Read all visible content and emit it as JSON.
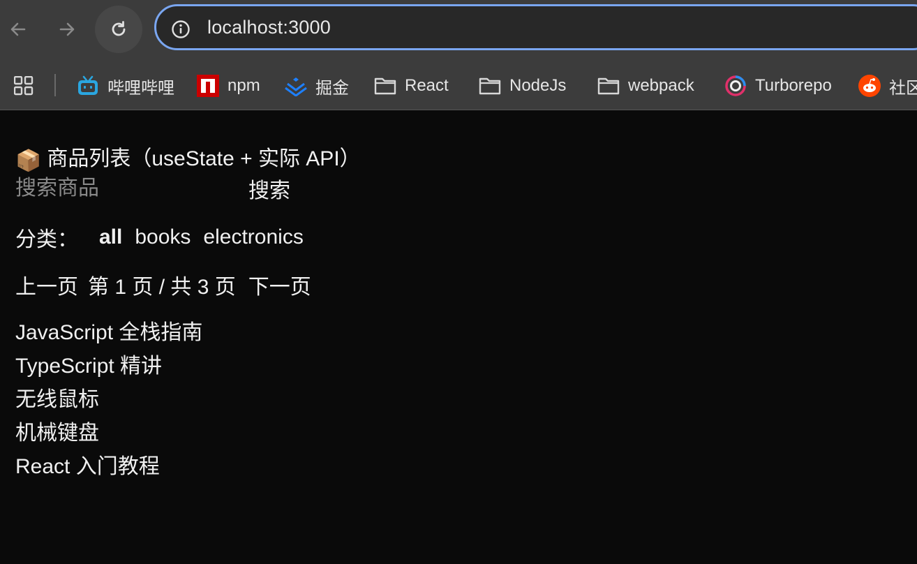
{
  "browser": {
    "url": "localhost:3000",
    "bookmarks": [
      {
        "label": "哔哩哔哩",
        "icon": "bilibili-icon"
      },
      {
        "label": "npm",
        "icon": "npm-icon"
      },
      {
        "label": "掘金",
        "icon": "juejin-icon"
      },
      {
        "label": "React",
        "icon": "folder-icon"
      },
      {
        "label": "NodeJs",
        "icon": "folder-icon"
      },
      {
        "label": "webpack",
        "icon": "folder-icon"
      },
      {
        "label": "Turborepo",
        "icon": "turborepo-icon"
      },
      {
        "label": "社区",
        "icon": "reddit-icon"
      }
    ]
  },
  "page": {
    "title_emoji": "📦",
    "title": "商品列表（useState + 实际 API）",
    "search": {
      "placeholder": "搜索商品",
      "value": "",
      "button_label": "搜索"
    },
    "category": {
      "label": "分类：",
      "options": [
        "all",
        "books",
        "electronics"
      ],
      "selected": "all"
    },
    "pagination": {
      "prev_label": "上一页",
      "info": "第 1 页 / 共 3 页",
      "next_label": "下一页"
    },
    "products": [
      "JavaScript 全栈指南",
      "TypeScript 精讲",
      "无线鼠标",
      "机械键盘",
      "React 入门教程"
    ]
  },
  "colors": {
    "page_background": "#0a0a0a",
    "chrome_background": "#3c3c3c",
    "omnibox_border": "#7aa6f0",
    "text": "#f0f0f0",
    "placeholder": "#8a8a8a"
  }
}
